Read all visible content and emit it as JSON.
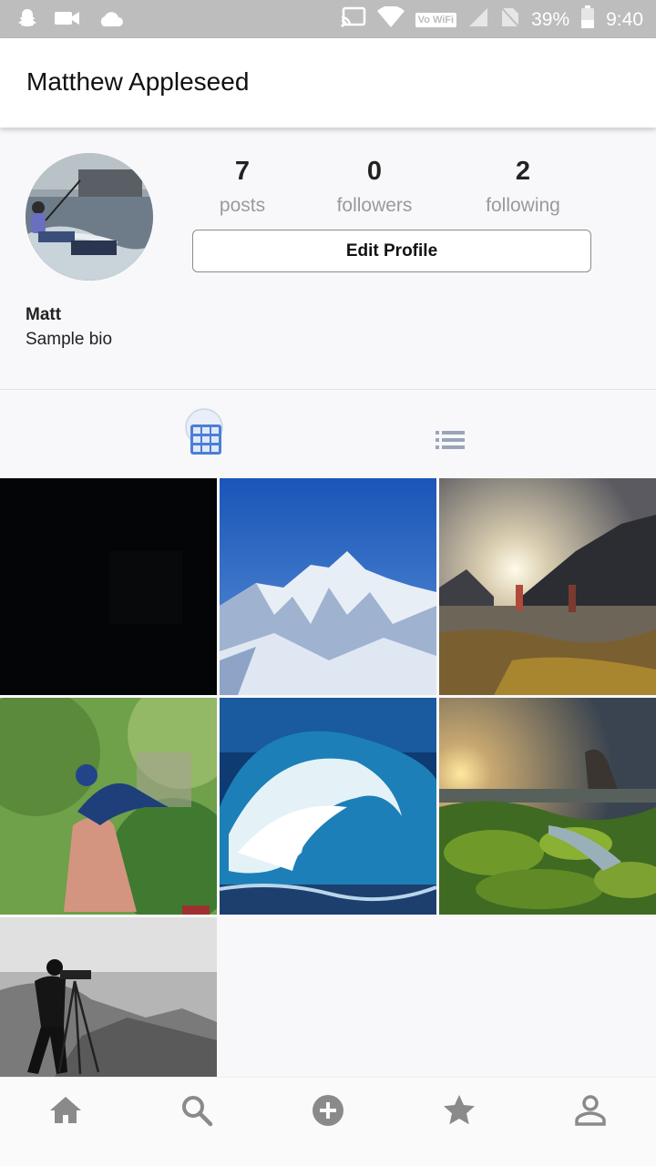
{
  "status_bar": {
    "battery_percent": "39%",
    "time": "9:40",
    "wifi_badge": "Vo WiFi",
    "icons": [
      "snapchat-icon",
      "video-icon",
      "cloud-icon",
      "cast-icon",
      "wifi-icon",
      "cellular-icon",
      "no-sim-icon",
      "battery-icon"
    ]
  },
  "app_bar": {
    "title": "Matthew Appleseed"
  },
  "profile": {
    "avatar": "kitesurfer-photo",
    "stats": [
      {
        "value": "7",
        "label": "posts"
      },
      {
        "value": "0",
        "label": "followers"
      },
      {
        "value": "2",
        "label": "following"
      }
    ],
    "edit_label": "Edit Profile",
    "name": "Matt",
    "bio": "Sample bio"
  },
  "tabs": [
    {
      "icon": "grid-icon",
      "active": true
    },
    {
      "icon": "list-icon",
      "active": false
    }
  ],
  "posts": [
    {
      "subject": "dark-image"
    },
    {
      "subject": "snowy-mountains"
    },
    {
      "subject": "children-at-sunset-lake"
    },
    {
      "subject": "bird-on-hand"
    },
    {
      "subject": "ocean-wave"
    },
    {
      "subject": "mossy-rocks-sunset"
    },
    {
      "subject": "photographer-with-tripod"
    }
  ],
  "bottom_nav": [
    {
      "icon": "home-icon"
    },
    {
      "icon": "search-icon"
    },
    {
      "icon": "add-circle-icon"
    },
    {
      "icon": "star-icon"
    },
    {
      "icon": "profile-icon"
    }
  ],
  "colors": {
    "accent": "#4a7fd4",
    "icon_gray": "#8a8a8a",
    "status_bar": "#bdbdbd"
  }
}
